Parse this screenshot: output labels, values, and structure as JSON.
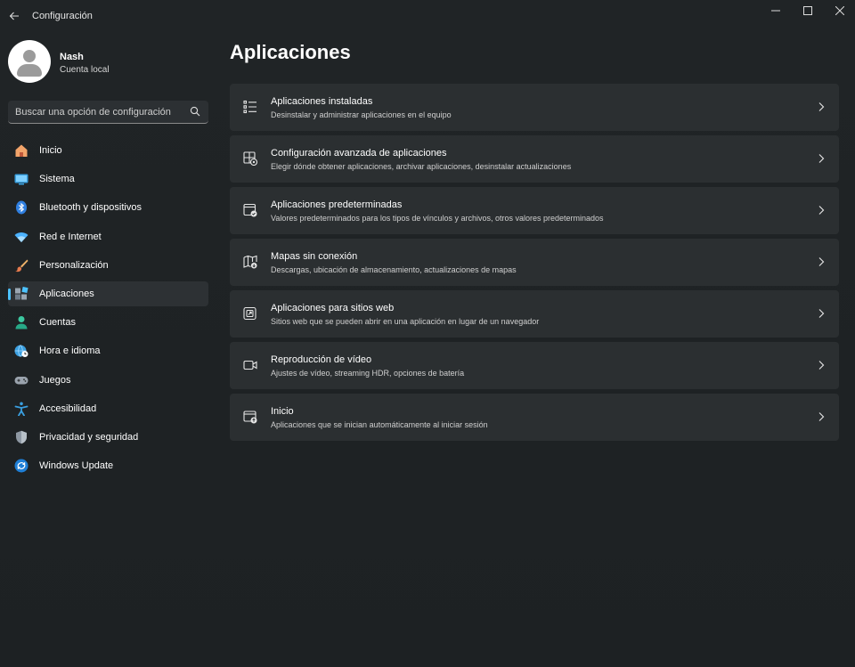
{
  "window": {
    "title": "Configuración",
    "controls": [
      "minimize-icon",
      "maximize-icon",
      "close-icon"
    ]
  },
  "profile": {
    "name": "Nash",
    "account_type": "Cuenta local"
  },
  "search": {
    "placeholder": "Buscar una opción de configuración",
    "icon": "search-icon"
  },
  "sidebar": {
    "active_item": "Aplicaciones",
    "accent_color": "#4cc2ff",
    "items": [
      {
        "label": "Inicio",
        "icon": "home-icon"
      },
      {
        "label": "Sistema",
        "icon": "monitor-icon"
      },
      {
        "label": "Bluetooth y dispositivos",
        "icon": "bluetooth-icon"
      },
      {
        "label": "Red e Internet",
        "icon": "wifi-icon"
      },
      {
        "label": "Personalización",
        "icon": "paintbrush-icon"
      },
      {
        "label": "Aplicaciones",
        "icon": "apps-icon"
      },
      {
        "label": "Cuentas",
        "icon": "person-icon"
      },
      {
        "label": "Hora e idioma",
        "icon": "globe-clock-icon"
      },
      {
        "label": "Juegos",
        "icon": "gamepad-icon"
      },
      {
        "label": "Accesibilidad",
        "icon": "accessibility-icon"
      },
      {
        "label": "Privacidad y seguridad",
        "icon": "shield-icon"
      },
      {
        "label": "Windows Update",
        "icon": "update-icon"
      }
    ]
  },
  "main": {
    "title": "Aplicaciones",
    "cards": [
      {
        "title": "Aplicaciones instaladas",
        "description": "Desinstalar y administrar aplicaciones en el equipo",
        "icon": "list-icon"
      },
      {
        "title": "Configuración avanzada de aplicaciones",
        "description": "Elegir dónde obtener aplicaciones, archivar aplicaciones, desinstalar actualizaciones",
        "icon": "apps-gear-icon"
      },
      {
        "title": "Aplicaciones predeterminadas",
        "description": "Valores predeterminados para los tipos de vínculos y archivos, otros valores predeterminados",
        "icon": "default-apps-icon"
      },
      {
        "title": "Mapas sin conexión",
        "description": "Descargas, ubicación de almacenamiento, actualizaciones de mapas",
        "icon": "map-download-icon"
      },
      {
        "title": "Aplicaciones para sitios web",
        "description": "Sitios web que se pueden abrir en una aplicación en lugar de un navegador",
        "icon": "open-external-icon"
      },
      {
        "title": "Reproducción de vídeo",
        "description": "Ajustes de vídeo, streaming HDR, opciones de batería",
        "icon": "video-icon"
      },
      {
        "title": "Inicio",
        "description": "Aplicaciones que se inician automáticamente al iniciar sesión",
        "icon": "startup-icon"
      }
    ]
  }
}
